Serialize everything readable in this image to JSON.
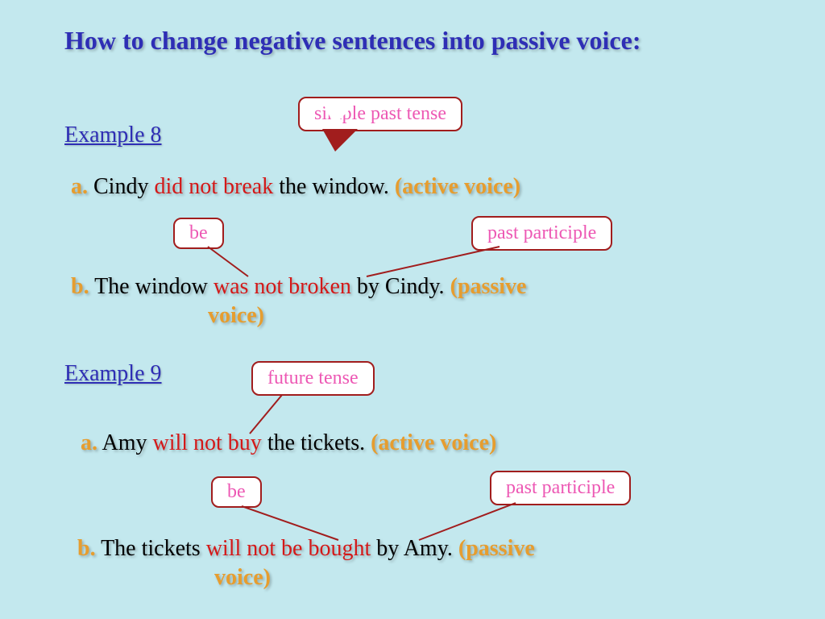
{
  "title": "How to change negative sentences into passive voice:",
  "example8": {
    "heading": "Example 8",
    "tense_callout": "simple past tense",
    "a": {
      "bullet": "a.",
      "pre": "Cindy ",
      "verb": "did not break",
      "post": " the window.   ",
      "voice": "(active voice)"
    },
    "be_callout": "be",
    "pp_callout": "past participle",
    "b": {
      "bullet": "b.",
      "pre": "The window ",
      "verb": "was not broken",
      "post": " by Cindy.  ",
      "voice": "(passive",
      "voice2": "voice)"
    }
  },
  "example9": {
    "heading": "Example 9",
    "tense_callout": "future tense",
    "a": {
      "bullet": "a.",
      "pre": "Amy ",
      "verb": "will not buy",
      "post": " the tickets.   ",
      "voice": "(active voice)"
    },
    "be_callout": "be",
    "pp_callout": "past participle",
    "b": {
      "bullet": "b.",
      "pre": "The tickets ",
      "verb": "will not be bought",
      "post": " by Amy.  ",
      "voice": "(passive",
      "voice2": "voice)"
    }
  }
}
